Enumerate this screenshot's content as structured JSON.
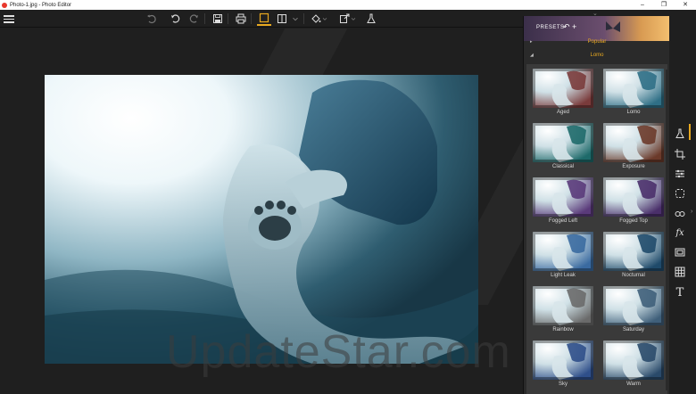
{
  "window": {
    "title": "Photo-1.jpg - Photo Editor",
    "minimize": "–",
    "maximize": "❐",
    "close": "✕"
  },
  "toolbar": {
    "buttons": [
      "menu",
      "undo",
      "redo-alt",
      "redo",
      "save",
      "print",
      "frame",
      "compare",
      "fill",
      "export",
      "effects"
    ]
  },
  "panel": {
    "header_label": "PRESETS",
    "header_icons": "↶ +",
    "sections": [
      {
        "name": "Popular",
        "collapsed": true
      },
      {
        "name": "Lomo",
        "collapsed": false
      }
    ],
    "presets": [
      {
        "label": "Aged"
      },
      {
        "label": "Lomo"
      },
      {
        "label": "Classical"
      },
      {
        "label": "Exposure"
      },
      {
        "label": "Fogged Left"
      },
      {
        "label": "Fogged Top"
      },
      {
        "label": "Light Leak"
      },
      {
        "label": "Nocturnal"
      },
      {
        "label": "Rainbow"
      },
      {
        "label": "Saturday"
      },
      {
        "label": "Sky"
      },
      {
        "label": "Warm"
      }
    ]
  },
  "canvas": {
    "watermark": "UpdateStar.com"
  },
  "colors": {
    "accent": "#e8a920",
    "background": "#1f1f1f",
    "panel": "#2a2a2a"
  },
  "tools": [
    "flask-icon",
    "crop-icon",
    "adjust-icon",
    "selection-icon",
    "glasses-icon",
    "fx-icon",
    "frame-icon",
    "texture-icon",
    "text-icon"
  ]
}
